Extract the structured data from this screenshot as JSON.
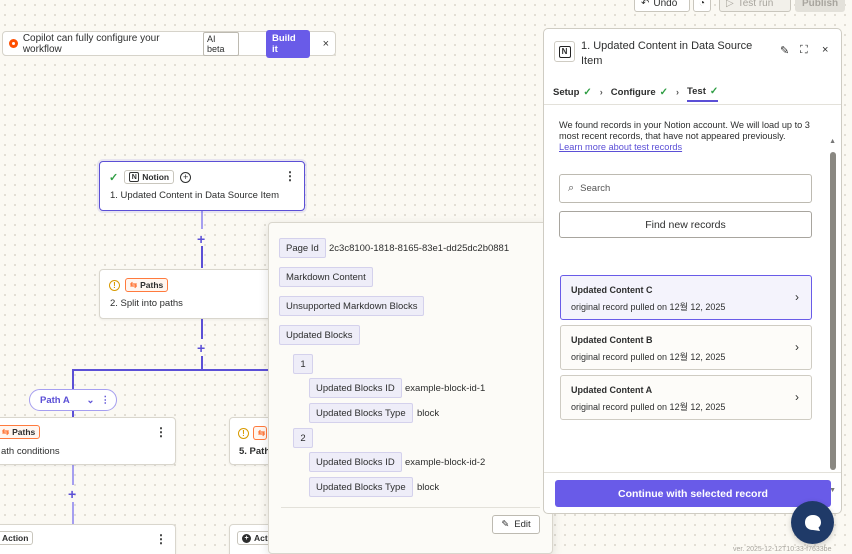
{
  "topbar": {
    "undo_label": "Undo",
    "test_run_label": "Test run",
    "publish_label": "Publish"
  },
  "copilot": {
    "message": "Copilot can fully configure your workflow",
    "ai_badge": "AI beta",
    "build_label": "Build it",
    "close_glyph": "×"
  },
  "canvas": {
    "trigger": {
      "app_badge": "Notion",
      "title": "1. Updated Content in Data Source Item"
    },
    "paths_node": {
      "badge": "Paths",
      "title": "2. Split into paths"
    },
    "path_pill": "Path A",
    "path_a_node": {
      "badge": "Paths",
      "title": "ath conditions"
    },
    "path_b_node": {
      "title": "5. Path"
    },
    "action_left": {
      "badge": "Action"
    },
    "action_right": {
      "badge": "Act"
    }
  },
  "popover": {
    "page_id_label": "Page Id",
    "page_id_value": "2c3c8100-1818-8165-83e1-dd25dc2b0881",
    "markdown_label": "Markdown Content",
    "unsupported_label": "Unsupported Markdown Blocks",
    "updated_blocks_label": "Updated Blocks",
    "items": [
      {
        "index": "1",
        "id_label": "Updated Blocks ID",
        "id_value": "example-block-id-1",
        "type_label": "Updated Blocks Type",
        "type_value": "block"
      },
      {
        "index": "2",
        "id_label": "Updated Blocks ID",
        "id_value": "example-block-id-2",
        "type_label": "Updated Blocks Type",
        "type_value": "block"
      }
    ],
    "edit_label": "Edit"
  },
  "panel": {
    "title": "1.  Updated Content in Data Source Item",
    "tabs": [
      {
        "label": "Setup"
      },
      {
        "label": "Configure"
      },
      {
        "label": "Test"
      }
    ],
    "info_text": "We found records in your Notion account. We will load up to 3 most recent records, that have not appeared previously.",
    "info_link": "Learn more about test records",
    "search_placeholder": "Search",
    "find_new_label": "Find new records",
    "records": [
      {
        "title": "Updated Content C",
        "subtitle": "original record pulled on 12월 12, 2025"
      },
      {
        "title": "Updated Content B",
        "subtitle": "original record pulled on 12월 12, 2025"
      },
      {
        "title": "Updated Content A",
        "subtitle": "original record pulled on 12월 12, 2025"
      }
    ],
    "continue_label": "Continue with selected record"
  },
  "version_text": "ver. 2025-12-12T10:33-f7633be",
  "colors": {
    "accent": "#695be8",
    "canvas_bg": "#fbf9f3",
    "paths_orange": "#ff7a3d",
    "success_green": "#2f9e44",
    "chat_fab": "#1f3a68"
  }
}
